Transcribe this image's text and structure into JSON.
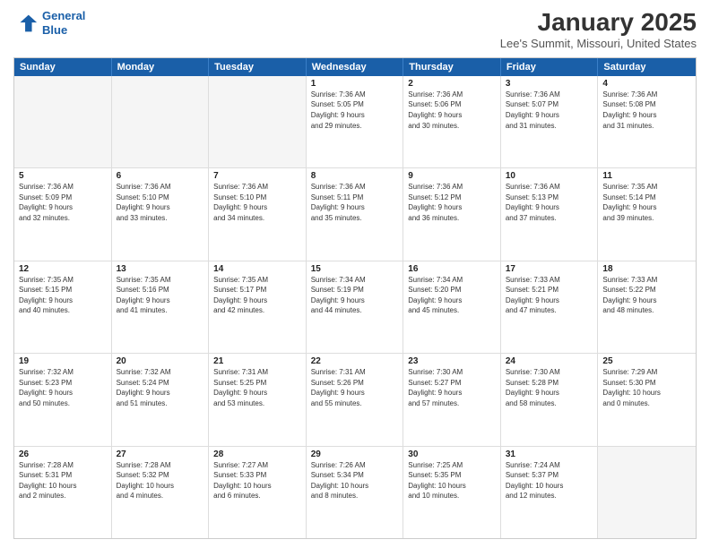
{
  "header": {
    "logo_line1": "General",
    "logo_line2": "Blue",
    "title": "January 2025",
    "subtitle": "Lee's Summit, Missouri, United States"
  },
  "days_of_week": [
    "Sunday",
    "Monday",
    "Tuesday",
    "Wednesday",
    "Thursday",
    "Friday",
    "Saturday"
  ],
  "weeks": [
    [
      {
        "day": "",
        "info": "",
        "empty": true
      },
      {
        "day": "",
        "info": "",
        "empty": true
      },
      {
        "day": "",
        "info": "",
        "empty": true
      },
      {
        "day": "1",
        "info": "Sunrise: 7:36 AM\nSunset: 5:05 PM\nDaylight: 9 hours\nand 29 minutes.",
        "empty": false
      },
      {
        "day": "2",
        "info": "Sunrise: 7:36 AM\nSunset: 5:06 PM\nDaylight: 9 hours\nand 30 minutes.",
        "empty": false
      },
      {
        "day": "3",
        "info": "Sunrise: 7:36 AM\nSunset: 5:07 PM\nDaylight: 9 hours\nand 31 minutes.",
        "empty": false
      },
      {
        "day": "4",
        "info": "Sunrise: 7:36 AM\nSunset: 5:08 PM\nDaylight: 9 hours\nand 31 minutes.",
        "empty": false
      }
    ],
    [
      {
        "day": "5",
        "info": "Sunrise: 7:36 AM\nSunset: 5:09 PM\nDaylight: 9 hours\nand 32 minutes.",
        "empty": false
      },
      {
        "day": "6",
        "info": "Sunrise: 7:36 AM\nSunset: 5:10 PM\nDaylight: 9 hours\nand 33 minutes.",
        "empty": false
      },
      {
        "day": "7",
        "info": "Sunrise: 7:36 AM\nSunset: 5:10 PM\nDaylight: 9 hours\nand 34 minutes.",
        "empty": false
      },
      {
        "day": "8",
        "info": "Sunrise: 7:36 AM\nSunset: 5:11 PM\nDaylight: 9 hours\nand 35 minutes.",
        "empty": false
      },
      {
        "day": "9",
        "info": "Sunrise: 7:36 AM\nSunset: 5:12 PM\nDaylight: 9 hours\nand 36 minutes.",
        "empty": false
      },
      {
        "day": "10",
        "info": "Sunrise: 7:36 AM\nSunset: 5:13 PM\nDaylight: 9 hours\nand 37 minutes.",
        "empty": false
      },
      {
        "day": "11",
        "info": "Sunrise: 7:35 AM\nSunset: 5:14 PM\nDaylight: 9 hours\nand 39 minutes.",
        "empty": false
      }
    ],
    [
      {
        "day": "12",
        "info": "Sunrise: 7:35 AM\nSunset: 5:15 PM\nDaylight: 9 hours\nand 40 minutes.",
        "empty": false
      },
      {
        "day": "13",
        "info": "Sunrise: 7:35 AM\nSunset: 5:16 PM\nDaylight: 9 hours\nand 41 minutes.",
        "empty": false
      },
      {
        "day": "14",
        "info": "Sunrise: 7:35 AM\nSunset: 5:17 PM\nDaylight: 9 hours\nand 42 minutes.",
        "empty": false
      },
      {
        "day": "15",
        "info": "Sunrise: 7:34 AM\nSunset: 5:19 PM\nDaylight: 9 hours\nand 44 minutes.",
        "empty": false
      },
      {
        "day": "16",
        "info": "Sunrise: 7:34 AM\nSunset: 5:20 PM\nDaylight: 9 hours\nand 45 minutes.",
        "empty": false
      },
      {
        "day": "17",
        "info": "Sunrise: 7:33 AM\nSunset: 5:21 PM\nDaylight: 9 hours\nand 47 minutes.",
        "empty": false
      },
      {
        "day": "18",
        "info": "Sunrise: 7:33 AM\nSunset: 5:22 PM\nDaylight: 9 hours\nand 48 minutes.",
        "empty": false
      }
    ],
    [
      {
        "day": "19",
        "info": "Sunrise: 7:32 AM\nSunset: 5:23 PM\nDaylight: 9 hours\nand 50 minutes.",
        "empty": false
      },
      {
        "day": "20",
        "info": "Sunrise: 7:32 AM\nSunset: 5:24 PM\nDaylight: 9 hours\nand 51 minutes.",
        "empty": false
      },
      {
        "day": "21",
        "info": "Sunrise: 7:31 AM\nSunset: 5:25 PM\nDaylight: 9 hours\nand 53 minutes.",
        "empty": false
      },
      {
        "day": "22",
        "info": "Sunrise: 7:31 AM\nSunset: 5:26 PM\nDaylight: 9 hours\nand 55 minutes.",
        "empty": false
      },
      {
        "day": "23",
        "info": "Sunrise: 7:30 AM\nSunset: 5:27 PM\nDaylight: 9 hours\nand 57 minutes.",
        "empty": false
      },
      {
        "day": "24",
        "info": "Sunrise: 7:30 AM\nSunset: 5:28 PM\nDaylight: 9 hours\nand 58 minutes.",
        "empty": false
      },
      {
        "day": "25",
        "info": "Sunrise: 7:29 AM\nSunset: 5:30 PM\nDaylight: 10 hours\nand 0 minutes.",
        "empty": false
      }
    ],
    [
      {
        "day": "26",
        "info": "Sunrise: 7:28 AM\nSunset: 5:31 PM\nDaylight: 10 hours\nand 2 minutes.",
        "empty": false
      },
      {
        "day": "27",
        "info": "Sunrise: 7:28 AM\nSunset: 5:32 PM\nDaylight: 10 hours\nand 4 minutes.",
        "empty": false
      },
      {
        "day": "28",
        "info": "Sunrise: 7:27 AM\nSunset: 5:33 PM\nDaylight: 10 hours\nand 6 minutes.",
        "empty": false
      },
      {
        "day": "29",
        "info": "Sunrise: 7:26 AM\nSunset: 5:34 PM\nDaylight: 10 hours\nand 8 minutes.",
        "empty": false
      },
      {
        "day": "30",
        "info": "Sunrise: 7:25 AM\nSunset: 5:35 PM\nDaylight: 10 hours\nand 10 minutes.",
        "empty": false
      },
      {
        "day": "31",
        "info": "Sunrise: 7:24 AM\nSunset: 5:37 PM\nDaylight: 10 hours\nand 12 minutes.",
        "empty": false
      },
      {
        "day": "",
        "info": "",
        "empty": true
      }
    ]
  ]
}
